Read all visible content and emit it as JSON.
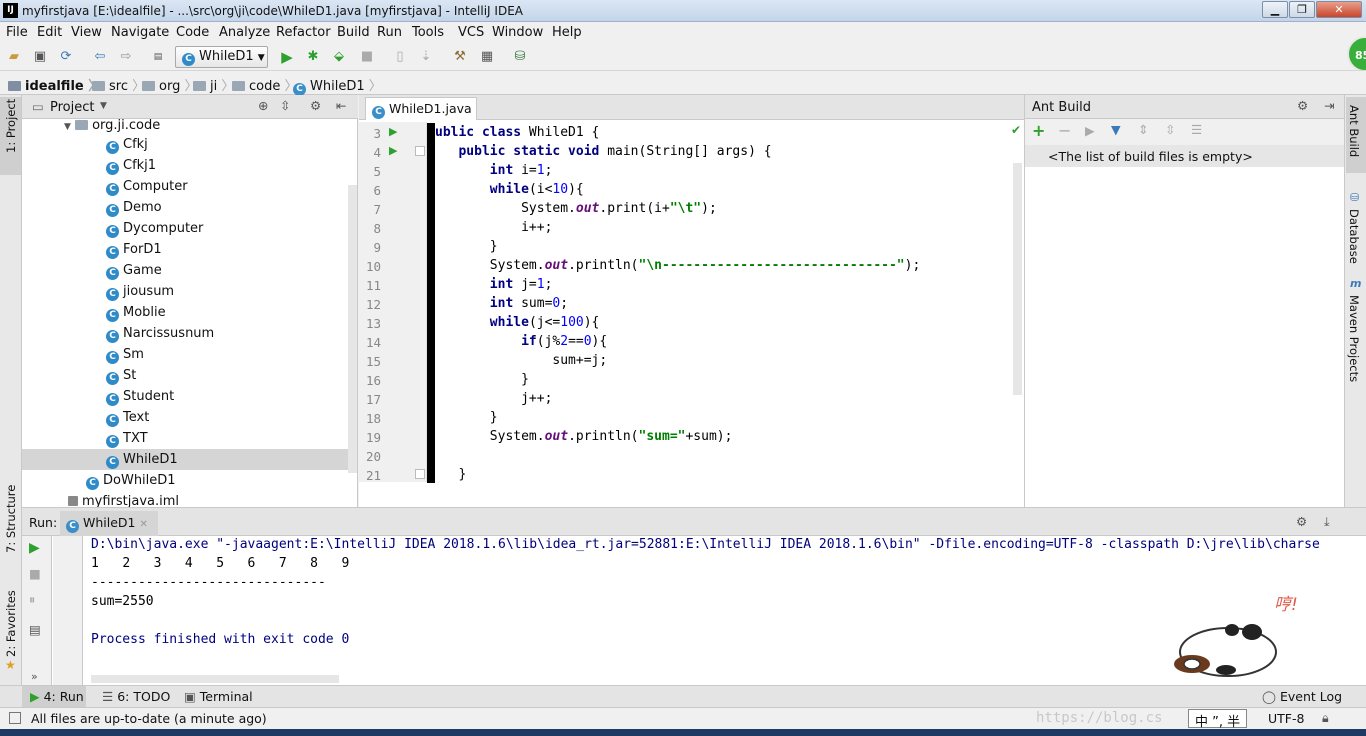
{
  "window": {
    "title": "myfirstjava [E:\\idealfile] - ...\\src\\org\\ji\\code\\WhileD1.java [myfirstjava] - IntelliJ IDEA",
    "logo": "IJ",
    "min": "▁",
    "max": "❐",
    "close": "✕"
  },
  "menu": [
    "File",
    "Edit",
    "View",
    "Navigate",
    "Code",
    "Analyze",
    "Refactor",
    "Build",
    "Run",
    "Tools",
    "VCS",
    "Window",
    "Help"
  ],
  "toolbar": {
    "run_config": "WhileD1",
    "badge": "85"
  },
  "breadcrumb": [
    "idealfile",
    "src",
    "org",
    "ji",
    "code",
    "WhileD1"
  ],
  "left_stripe": {
    "project": "1: Project",
    "structure": "7: Structure",
    "favorites": "2: Favorites"
  },
  "right_stripe": {
    "ant": "Ant Build",
    "database": "Database",
    "maven": "Maven Projects"
  },
  "project_panel": {
    "title": "Project",
    "package": "org.ji.code",
    "classes": [
      "Cfkj",
      "Cfkj1",
      "Computer",
      "Demo",
      "Dycomputer",
      "ForD1",
      "Game",
      "jiousum",
      "Moblie",
      "Narcissusnum",
      "Sm",
      "St",
      "Student",
      "Text",
      "TXT",
      "WhileD1"
    ],
    "extra_class": "DoWhileD1",
    "iml": "myfirstjava.iml",
    "selected": "WhileD1"
  },
  "editor": {
    "tab": "WhileD1.java",
    "line_numbers": [
      "3",
      "4",
      "5",
      "6",
      "7",
      "8",
      "9",
      "10",
      "11",
      "12",
      "13",
      "14",
      "15",
      "16",
      "17",
      "18",
      "19",
      "20",
      "21"
    ]
  },
  "ant_panel": {
    "title": "Ant Build",
    "empty_message": "<The list of build files is empty>"
  },
  "run_panel": {
    "label": "Run:",
    "tab": "WhileD1",
    "output": [
      "D:\\bin\\java.exe \"-javaagent:E:\\IntelliJ IDEA 2018.1.6\\lib\\idea_rt.jar=52881:E:\\IntelliJ IDEA 2018.1.6\\bin\" -Dfile.encoding=UTF-8 -classpath D:\\jre\\lib\\charse",
      "1\t2\t3\t4\t5\t6\t7\t8\t9",
      "------------------------------",
      "sum=2550",
      "",
      "Process finished with exit code 0"
    ],
    "sticker_text": "哼!"
  },
  "bottom_tabs": {
    "run": "4: Run",
    "todo": "6: TODO",
    "terminal": "Terminal",
    "event_log": "Event Log"
  },
  "status": {
    "message": "All files are up-to-date (a minute ago)",
    "encoding": "UTF-8",
    "ime": "中 ”, 半",
    "watermark": "https://blog.cs"
  }
}
